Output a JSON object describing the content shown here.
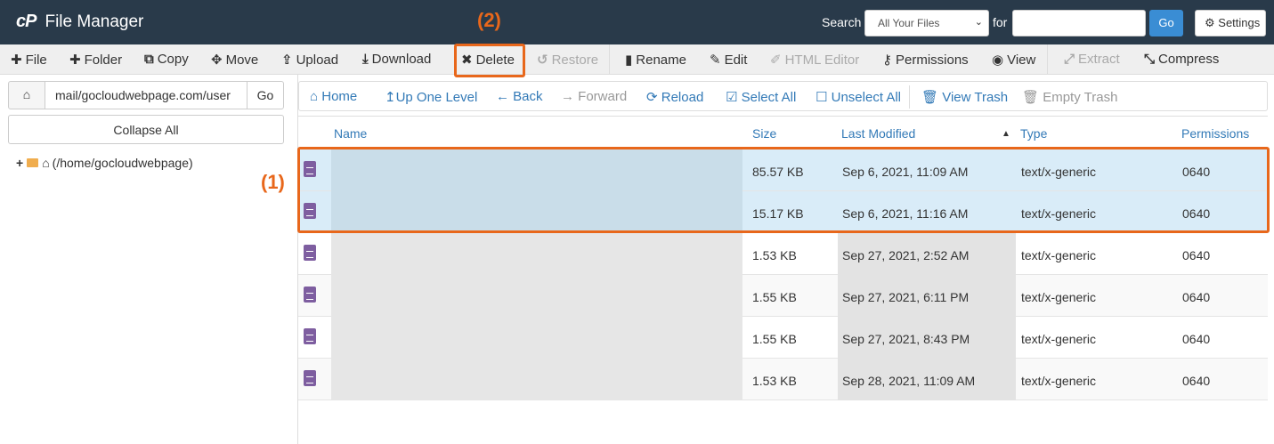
{
  "header": {
    "logo": "cP",
    "title": "File Manager",
    "search_label": "Search",
    "search_scope": "All Your Files",
    "for_label": "for",
    "search_value": "",
    "go_label": "Go",
    "settings_label": "Settings"
  },
  "toolbar": {
    "file": "File",
    "folder": "Folder",
    "copy": "Copy",
    "move": "Move",
    "upload": "Upload",
    "download": "Download",
    "delete": "Delete",
    "restore": "Restore",
    "rename": "Rename",
    "edit": "Edit",
    "html_editor": "HTML Editor",
    "permissions": "Permissions",
    "view": "View",
    "extract": "Extract",
    "compress": "Compress"
  },
  "annotations": {
    "label_1": "(1)",
    "label_2": "(2)",
    "color": "#e8671b"
  },
  "sidebar": {
    "path_value": "mail/gocloudwebpage.com/user",
    "go_label": "Go",
    "collapse_label": "Collapse All",
    "tree_root": "(/home/gocloudwebpage)"
  },
  "nav": {
    "home": "Home",
    "up_one_level": "Up One Level",
    "back": "Back",
    "forward": "Forward",
    "reload": "Reload",
    "select_all": "Select All",
    "unselect_all": "Unselect All",
    "view_trash": "View Trash",
    "empty_trash": "Empty Trash"
  },
  "columns": {
    "name": "Name",
    "size": "Size",
    "last_modified": "Last Modified",
    "type": "Type",
    "permissions": "Permissions"
  },
  "rows": [
    {
      "size": "85.57 KB",
      "modified": "Sep 6, 2021, 11:09 AM",
      "type": "text/x-generic",
      "perms": "0640"
    },
    {
      "size": "15.17 KB",
      "modified": "Sep 6, 2021, 11:16 AM",
      "type": "text/x-generic",
      "perms": "0640"
    },
    {
      "size": "1.53 KB",
      "modified": "Sep 27, 2021, 2:52 AM",
      "type": "text/x-generic",
      "perms": "0640"
    },
    {
      "size": "1.55 KB",
      "modified": "Sep 27, 2021, 6:11 PM",
      "type": "text/x-generic",
      "perms": "0640"
    },
    {
      "size": "1.55 KB",
      "modified": "Sep 27, 2021, 8:43 PM",
      "type": "text/x-generic",
      "perms": "0640"
    },
    {
      "size": "1.53 KB",
      "modified": "Sep 28, 2021, 11:09 AM",
      "type": "text/x-generic",
      "perms": "0640"
    }
  ],
  "colors": {
    "topbar": "#293a4a",
    "link": "#337ab7",
    "selected_row": "#d9ecf8",
    "file_icon": "#7e5ea0",
    "go_button": "#3a8dd4"
  }
}
